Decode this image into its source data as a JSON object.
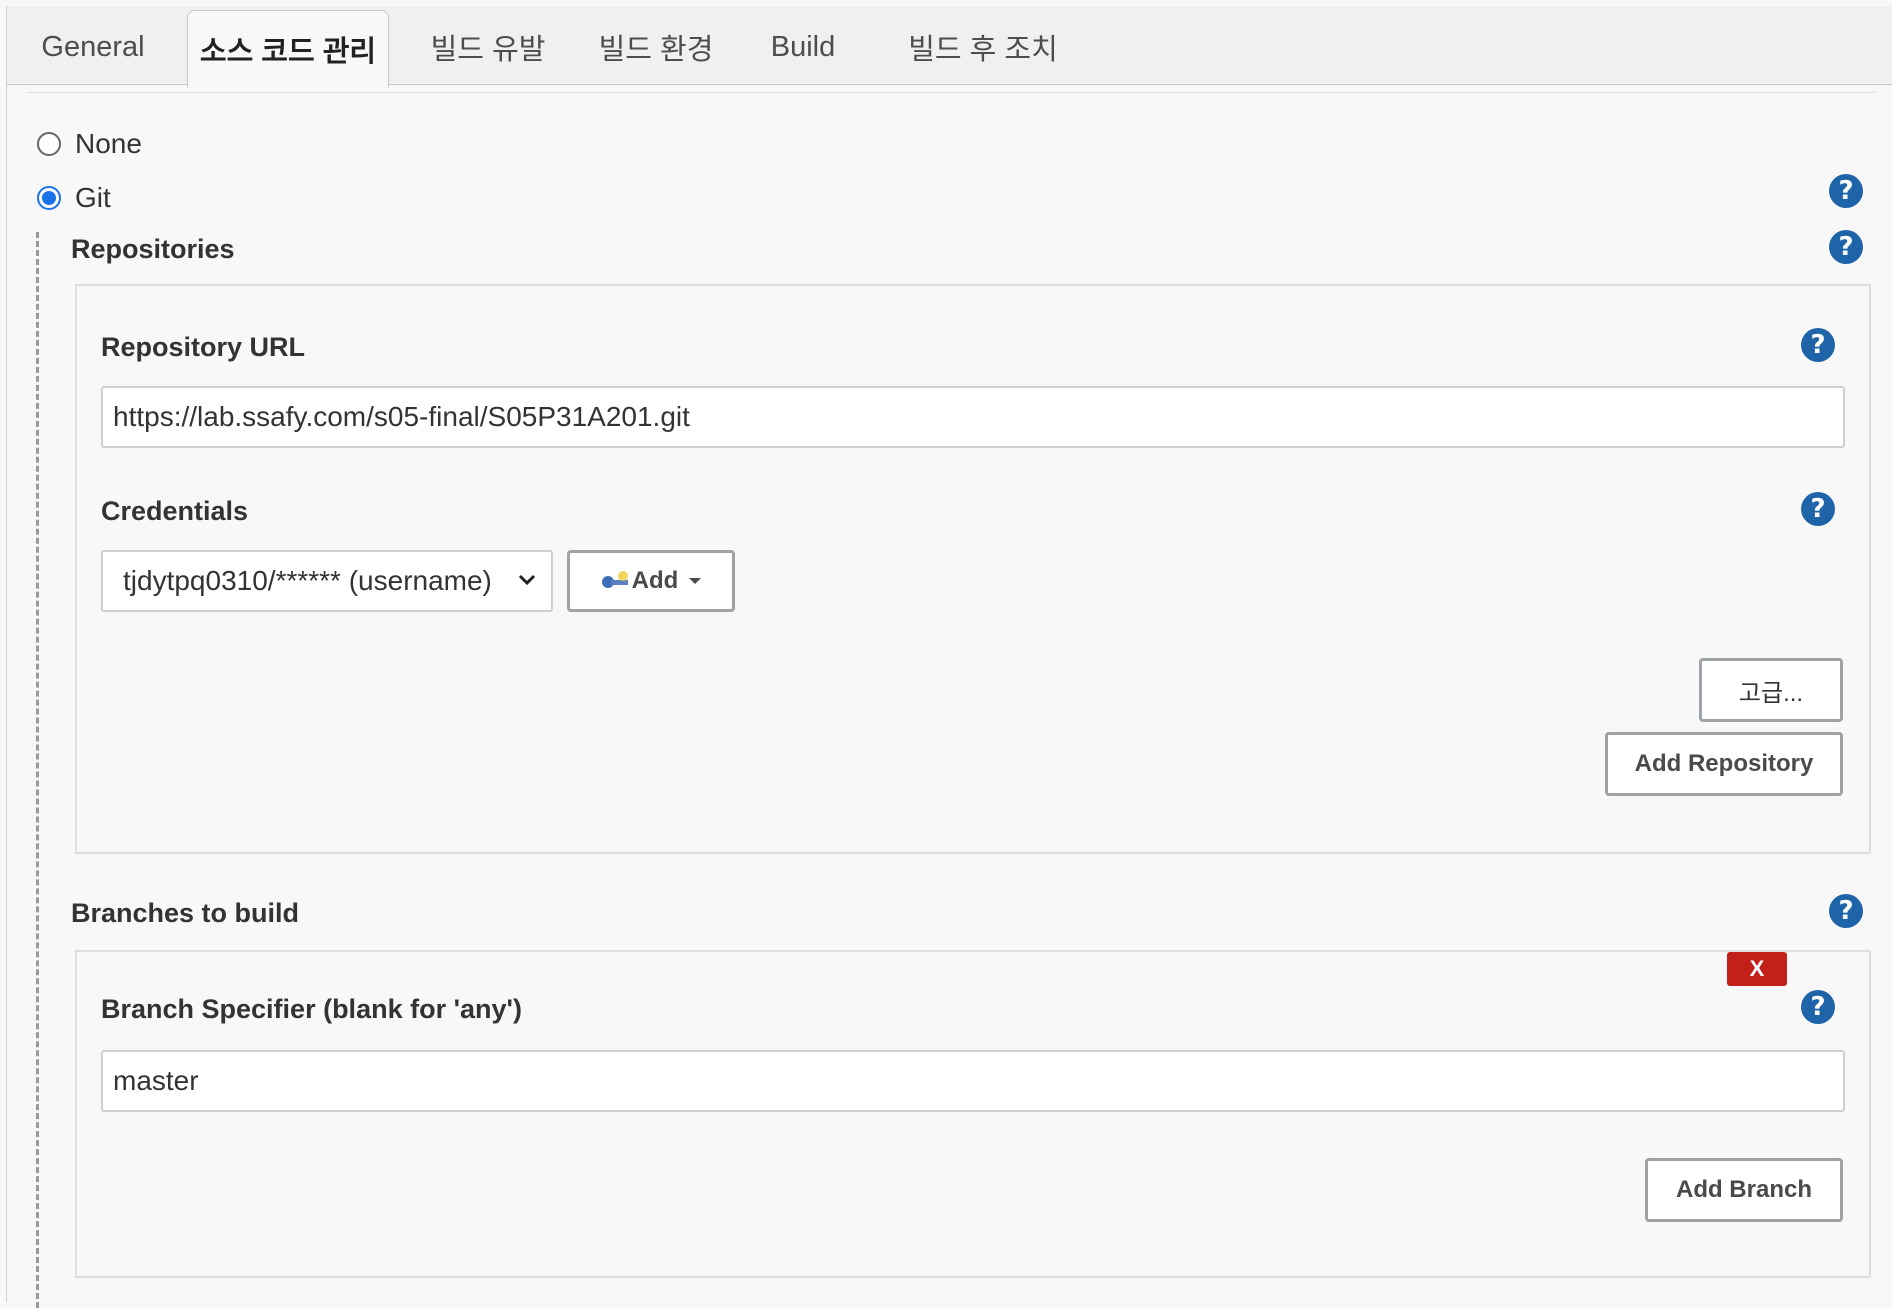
{
  "tabs": [
    {
      "label": "General",
      "active": false
    },
    {
      "label": "소스 코드 관리",
      "active": true
    },
    {
      "label": "빌드 유발",
      "active": false
    },
    {
      "label": "빌드 환경",
      "active": false
    },
    {
      "label": "Build",
      "active": false
    },
    {
      "label": "빌드 후 조치",
      "active": false
    }
  ],
  "scm": {
    "options": [
      {
        "label": "None",
        "checked": false
      },
      {
        "label": "Git",
        "checked": true
      }
    ]
  },
  "repositories": {
    "title": "Repositories",
    "url_label": "Repository URL",
    "url_value": "https://lab.ssafy.com/s05-final/S05P31A201.git",
    "credentials_label": "Credentials",
    "credentials_value": "tjdytpq0310/****** (username)",
    "add_label": "Add",
    "advanced_label": "고급...",
    "add_repository_label": "Add Repository"
  },
  "branches": {
    "title": "Branches to build",
    "delete_label": "X",
    "specifier_label": "Branch Specifier (blank for 'any')",
    "specifier_value": "master",
    "add_branch_label": "Add Branch"
  },
  "colors": {
    "help_icon": "#1f64a8",
    "radio_checked": "#1a73e8",
    "delete_button": "#c4201a"
  },
  "icons": {
    "help": "question-circle-icon",
    "credentials_add": "key-icon",
    "dropdown": "chevron-down-icon"
  }
}
